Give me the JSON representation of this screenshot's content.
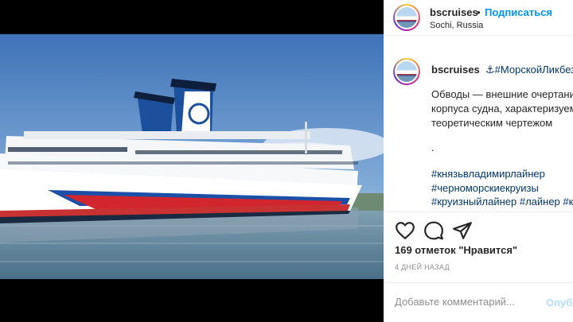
{
  "post": {
    "username": "bscruises",
    "separator": "•",
    "follow_label": "Подписаться",
    "location": "Sochi, Russia"
  },
  "caption": {
    "username": "bscruises",
    "first_tag": "⚓#МорскойЛикбез",
    "lines": [
      "Обводы — внешние очертани",
      "корпуса судна, характеризуем",
      "теоретическим чертежом"
    ],
    "dot": ".",
    "hashtags": [
      "#князьвладимирлайнер",
      "#черноморскиекруизы",
      "#круизныйлайнер #лайнер #к"
    ]
  },
  "icons": {
    "like": "heart-icon",
    "comment": "comment-icon",
    "share": "paper-plane-icon"
  },
  "stats": {
    "likes": "169 отметок \"Нравится\"",
    "date": "4 ДНЕЙ НАЗАД"
  },
  "comment_box": {
    "placeholder": "Добавьте комментарий...",
    "publish_label": "Опубл"
  },
  "colors": {
    "link": "#0095f6",
    "hashtag": "#00376b",
    "publish_disabled": "#b2dffc"
  }
}
